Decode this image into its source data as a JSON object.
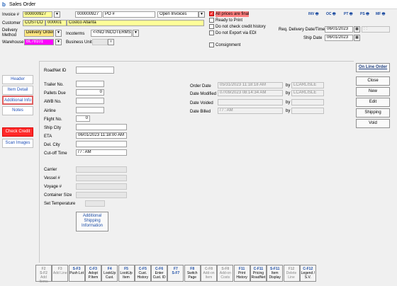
{
  "window": {
    "title": "Sales Order",
    "icon": "b"
  },
  "header": {
    "invoice_label": "Invoice #",
    "invoice_value": "000000927",
    "invoice_value2": "000000927",
    "po_label": "PO #",
    "invoice_filter": "Open Invoices",
    "customer_label": "Customer",
    "customer_code": "COSTCO",
    "customer_num": "000001",
    "customer_name": "Costco Atlanta",
    "delivery_method_label": "Delivery Method",
    "delivery_method_value": "Delivery Order",
    "incoterms_label": "Incoterms",
    "incoterms_value": "<<NO INCOTERMS>>",
    "warehouse_label": "Warehouse",
    "warehouse_value": "BL78101",
    "business_unit_label": "Business Unit",
    "checks": [
      {
        "label": "All prices are final",
        "checked": true
      },
      {
        "label": "Ready to Print",
        "checked": false
      },
      {
        "label": "Do not check credit history",
        "checked": false
      },
      {
        "label": "Do not Export via EDI",
        "checked": false
      }
    ],
    "consignment_label": "Consignment",
    "req_delivery_label": "Req. Delivery Date/Time",
    "req_delivery_date": "06/01/2023",
    "req_delivery_time": ": :",
    "ship_date_label": "Ship Date",
    "ship_date_value": "06/01/2023"
  },
  "toolbar": [
    "INV",
    "OC",
    "PT",
    "PS",
    "MF"
  ],
  "sidebar": [
    "Header",
    "Item Detail",
    "Additional Info",
    "Notes",
    "Check Credit",
    "Scan Images"
  ],
  "form": {
    "roadnet_label": "RoadNet ID",
    "trailer_label": "Trailer No.",
    "pallets_label": "Pallets Due",
    "pallets_value": "0",
    "awb_label": "AWB No.",
    "airline_label": "Airline",
    "flight_label": "Flight No.",
    "flight_value": "0",
    "ship_city_label": "Ship City",
    "eta_label": "ETA",
    "eta_value": "06/01/2023 11:18:00 AM",
    "del_city_label": "Del. City",
    "cutoff_label": "Cut-off Time",
    "cutoff_value": "/ /        :      AM",
    "carrier_label": "Carrier",
    "vessel_label": "Vessel #",
    "voyage_label": "Voyage #",
    "container_label": "Container Size",
    "set_temp_label": "Set Temperature",
    "additional_button": "Additional Shipping Information",
    "order_date_label": "Order Date",
    "order_date_value": "05/31/2023 11:18:18 AM",
    "order_by": "LCARLISLE",
    "date_modified_label": "Date Modified",
    "date_modified_value": "07/09/2023 08:14:34 AM",
    "modified_by": "LCARLISLE",
    "date_voided_label": "Date Voided",
    "date_billed_label": "Date Billed",
    "date_billed_value": "/ /        :      AM",
    "by_label": "by"
  },
  "right_buttons": [
    "On Line Order",
    "Close",
    "New",
    "Edit",
    "Shipping",
    "Void"
  ],
  "fkeys": [
    {
      "key": "F2",
      "sub": "S-F2",
      "label": "Add Items",
      "dim": true
    },
    {
      "key": "F3",
      "sub": "",
      "label": "Add Line",
      "dim": true
    },
    {
      "key": "S-F3",
      "sub": "",
      "label": "Push Lot",
      "dim": false
    },
    {
      "key": "C-F3",
      "sub": "",
      "label": "Adopt P.Item",
      "dim": false
    },
    {
      "key": "F4",
      "sub": "",
      "label": "LookUp Cust.",
      "dim": false
    },
    {
      "key": "F5",
      "sub": "",
      "label": "LookUp Item",
      "dim": false
    },
    {
      "key": "C-F5",
      "sub": "",
      "label": "Cust. History",
      "dim": false
    },
    {
      "key": "C-F6",
      "sub": "",
      "label": "Enter Cust. ID",
      "dim": false
    },
    {
      "key": "F7",
      "sub": "S-F7",
      "label": "",
      "dim": false
    },
    {
      "key": "F8",
      "sub": "",
      "label": "Switch Page",
      "dim": false
    },
    {
      "key": "C-F8",
      "sub": "",
      "label": "Add-on Item",
      "dim": true
    },
    {
      "key": "S-F8",
      "sub": "",
      "label": "Add-on Costs",
      "dim": true
    },
    {
      "key": "F11",
      "sub": "",
      "label": "Print History",
      "dim": false
    },
    {
      "key": "C-F11",
      "sub": "",
      "label": "Pricing RoadNet",
      "dim": false
    },
    {
      "key": "S-F11",
      "sub": "",
      "label": "Item Display",
      "dim": false
    },
    {
      "key": "F12",
      "sub": "",
      "label": "Delete Line",
      "dim": true
    },
    {
      "key": "C-F12",
      "sub": "",
      "label": "Legend / S.V.",
      "dim": false
    }
  ]
}
